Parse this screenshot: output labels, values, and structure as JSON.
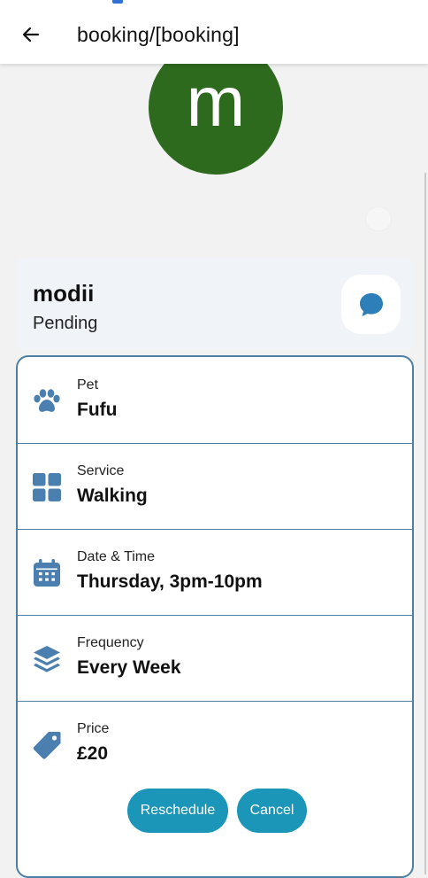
{
  "header": {
    "title": "booking/[booking]",
    "back_icon": "arrow-left-icon"
  },
  "avatar": {
    "letter": "m",
    "color": "#2e6a1e"
  },
  "sitter": {
    "name": "modii",
    "status": "Pending",
    "chat_icon": "chat-bubble-icon"
  },
  "details": {
    "items": [
      {
        "icon": "paw-icon",
        "label": "Pet",
        "value": "Fufu"
      },
      {
        "icon": "grid-icon",
        "label": "Service",
        "value": "Walking"
      },
      {
        "icon": "calendar-icon",
        "label": "Date & Time",
        "value": "Thursday, 3pm-10pm"
      },
      {
        "icon": "layers-icon",
        "label": "Frequency",
        "value": "Every Week"
      },
      {
        "icon": "price-tag-icon",
        "label": "Price",
        "value": "£20"
      }
    ]
  },
  "actions": {
    "reschedule_label": "Reschedule",
    "cancel_label": "Cancel"
  },
  "colors": {
    "accent_icon": "#4a7fb0",
    "button": "#1b95b8",
    "card_border": "#4f7fa3"
  }
}
